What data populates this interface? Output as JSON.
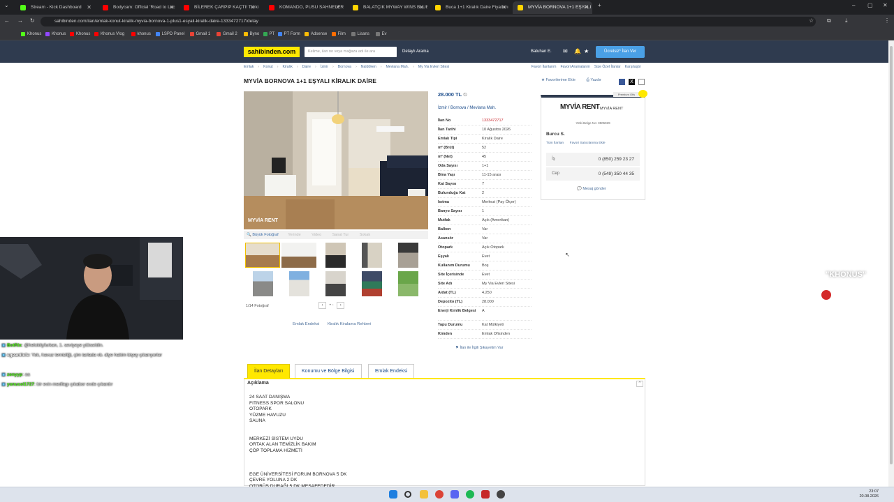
{
  "browser": {
    "tabs": [
      {
        "title": "Stream - Kick Dashboard",
        "color": "#53fc18"
      },
      {
        "title": "Bodycam: Official 'Road to Loc",
        "color": "#ff0000"
      },
      {
        "title": "BİLEREK ÇARPIP KAÇTI! Türkiy",
        "color": "#ff0000"
      },
      {
        "title": "KOMANDO, PUSU SAHNELERİ",
        "color": "#ff0000"
      },
      {
        "title": "BALATÇIK MYWAY WINS BLUE",
        "color": "#ffd400"
      },
      {
        "title": "Buca 1+1 Kiralık Daire Fiyatları",
        "color": "#ffd400"
      },
      {
        "title": "MYVİA BORNOVA 1+1 EŞYALI",
        "color": "#ffd400"
      }
    ],
    "url": "sahibinden.com/ilan/emlak-konut-kiralik-myvia-bornova-1-plus1-esyali-kiralik-daire-1333472717/detay",
    "bookmarks": [
      "Khonus",
      "Khonus",
      "Khonus",
      "Khonus Vlog",
      "khonus",
      "LSPD Panel",
      "Gmail 1",
      "Gmail 2",
      "Byno",
      "PT",
      "PT Form",
      "Adsense",
      "Film",
      "Lisans",
      "Ev"
    ]
  },
  "site": {
    "logo": "sahibinden.com",
    "search_placeholder": "Kelime, ilan no veya mağaza adı ile ara",
    "detailed_search": "Detaylı Arama",
    "user": "Batuhan E.",
    "post_ad": "Ücretsiz* İlan Ver",
    "brand_color": "#ffe800",
    "header_color": "#2f3b4f"
  },
  "breadcrumbs": [
    "Emlak",
    "Konut",
    "Kiralık",
    "Daire",
    "İzmir",
    "Bornova",
    "Naldöken",
    "Mevlana Mah.",
    "My Via Evleri Sitesi"
  ],
  "right_links": [
    "Favori İlanlarım",
    "Favori Aramalarım",
    "Size Özel İlanlar",
    "Karşılaştır"
  ],
  "listing": {
    "title": "MYVİA BORNOVA 1+1 EŞYALI KİRALIK DAİRE",
    "add_favorite": "Favorilerime Ekle",
    "print": "Yazdır",
    "price": "28.000 TL",
    "location": [
      "İzmir",
      "Bornova",
      "Mevlana Mah."
    ],
    "photo_watermark": "MYVİA RENT",
    "big_photo": "Büyük Fotoğraf",
    "photo_tabs": [
      "Yerinde",
      "Video",
      "Sanal Tur",
      "Sokak"
    ],
    "photo_count": "1/14 Fotoğraf",
    "gallery_links": [
      "Emlak Endeksi",
      "Kiralık Kiralama Rehberi"
    ],
    "specs": [
      {
        "k": "İlan No",
        "v": "1333472717",
        "red": true
      },
      {
        "k": "İlan Tarihi",
        "v": "10 Ağustos 2026"
      },
      {
        "k": "Emlak Tipi",
        "v": "Kiralık Daire"
      },
      {
        "k": "m² (Brüt)",
        "v": "52"
      },
      {
        "k": "m² (Net)",
        "v": "45"
      },
      {
        "k": "Oda Sayısı",
        "v": "1+1"
      },
      {
        "k": "Bina Yaşı",
        "v": "11-15 arası"
      },
      {
        "k": "Kat Sayısı",
        "v": "7"
      },
      {
        "k": "Bulunduğu Kat",
        "v": "2"
      },
      {
        "k": "Isıtma",
        "v": "Merkezi (Pay Ölçer)"
      },
      {
        "k": "Banyo Sayısı",
        "v": "1"
      },
      {
        "k": "Mutfak",
        "v": "Açık (Amerikan)"
      },
      {
        "k": "Balkon",
        "v": "Var"
      },
      {
        "k": "Asansör",
        "v": "Var"
      },
      {
        "k": "Otopark",
        "v": "Açık Otopark"
      },
      {
        "k": "Eşyalı",
        "v": "Evet"
      },
      {
        "k": "Kullanım Durumu",
        "v": "Boş"
      },
      {
        "k": "Site İçerisinde",
        "v": "Evet"
      },
      {
        "k": "Site Adı",
        "v": "My Via Evleri Sitesi"
      },
      {
        "k": "Aidat (TL)",
        "v": "4.250"
      },
      {
        "k": "Depozito (TL)",
        "v": "28.000"
      },
      {
        "k": "Enerji Kimlik Belgesi",
        "v": "A",
        "tall": true
      },
      {
        "k": "Tapu Durumu",
        "v": "Kat Mülkiyeti"
      },
      {
        "k": "Kimden",
        "v": "Emlak Ofisinden"
      }
    ],
    "complaint": "İlan ile İlgili Şikayetim Var"
  },
  "seller": {
    "premium": "Premium Ofis",
    "logo": "MYVİA RENT",
    "company": "MYVİA RENT",
    "authority": "Yetki Belge No: 3505929",
    "name": "Burcu S.",
    "links": [
      "Tüm İlanları",
      "Favori Satıcılarıma Ekle"
    ],
    "phones": [
      {
        "label": "İş",
        "number": "0 (850) 259 23 27"
      },
      {
        "label": "Cep",
        "number": "0 (549) 350 44 35"
      }
    ],
    "message": "Mesaj gönder"
  },
  "tabs": [
    "İlan Detayları",
    "Konumu ve Bölge Bilgisi",
    "Emlak Endeksi"
  ],
  "description": {
    "heading": "Açıklama",
    "lines": [
      "24 SAAT DANIŞMA",
      "FITNESS SPOR SALONU",
      "OTOPARK",
      "YÜZME HAVUZU",
      "SAUNA",
      "",
      "",
      "MERKEZİ SİSTEM UYDU",
      "ORTAK ALAN TEMİZLİK BAKIM",
      "ÇÖP TOPLAMA HİZMETİ",
      "",
      "",
      "",
      "EGE ÜNİVERSİTESİ FORUM BORNOVA 5 DK",
      "ÇEVRE YOLUNA 2 DK",
      "OTOBÜS DURAĞI 5 DK MESAFEDEDİR"
    ]
  },
  "stream": {
    "chat": [
      {
        "user": "BotRix",
        "msg": ": @helokityfurkan, 1. seviyeye yükseldin.",
        "color": "#53fc18"
      },
      {
        "user": "egeanilefe",
        "msg": ": Yok, havuz temizliği, çim tarlada vb. diye hakim bişey çıkarıyorlar",
        "color": "#ffffff"
      },
      {
        "user": "zenyyp",
        "msg": ": aa",
        "color": "#53fc18"
      },
      {
        "user": "yonucel1727",
        "msg": ": bir evin medfagı çıkabor evde çıkardır",
        "color": "#53fc18"
      }
    ],
    "overlay_text": "\"KHONUS\""
  },
  "taskbar": {
    "time": "23:07",
    "date": "20.08.2026"
  }
}
